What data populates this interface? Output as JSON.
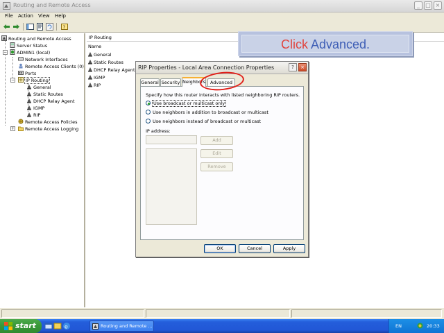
{
  "window": {
    "title": "Routing and Remote Access",
    "minimize": "_",
    "maximize": "□",
    "close": "×"
  },
  "menu": {
    "file": "File",
    "action": "Action",
    "view": "View",
    "help": "Help"
  },
  "tree": {
    "root": "Routing and Remote Access",
    "server_status": "Server Status",
    "server": "ADMIN1 (local)",
    "network_interfaces": "Network Interfaces",
    "remote_access_clients": "Remote Access Clients (0)",
    "ports": "Ports",
    "ip_routing": "IP Routing",
    "general": "General",
    "static_routes": "Static Routes",
    "dhcp_relay_agent": "DHCP Relay Agent",
    "igmp": "IGMP",
    "rip": "RIP",
    "remote_access_policies": "Remote Access Policies",
    "remote_access_logging": "Remote Access Logging"
  },
  "right_pane": {
    "header": "IP Routing",
    "column_name": "Name",
    "items": [
      "General",
      "Static Routes",
      "DHCP Relay Agent",
      "IGMP",
      "RIP"
    ]
  },
  "callout": {
    "click": "Click",
    "target": "Advanced."
  },
  "dialog": {
    "title": "RIP Properties - Local Area Connection Properties",
    "help": "?",
    "close": "×",
    "tabs": [
      "General",
      "Security",
      "Neighbors",
      "Advanced"
    ],
    "description": "Specify how this router interacts with listed neighboring RIP routers.",
    "options": [
      "Use broadcast or multicast only",
      "Use neighbors in addition to broadcast or multicast",
      "Use neighbors instead of broadcast or multicast"
    ],
    "ip_address_label": "IP address:",
    "add": "Add",
    "edit": "Edit",
    "remove": "Remove",
    "ok": "OK",
    "cancel": "Cancel",
    "apply": "Apply"
  },
  "taskbar": {
    "start": "start",
    "task": "Routing and Remote ...",
    "language": "EN",
    "clock": "20:33"
  }
}
